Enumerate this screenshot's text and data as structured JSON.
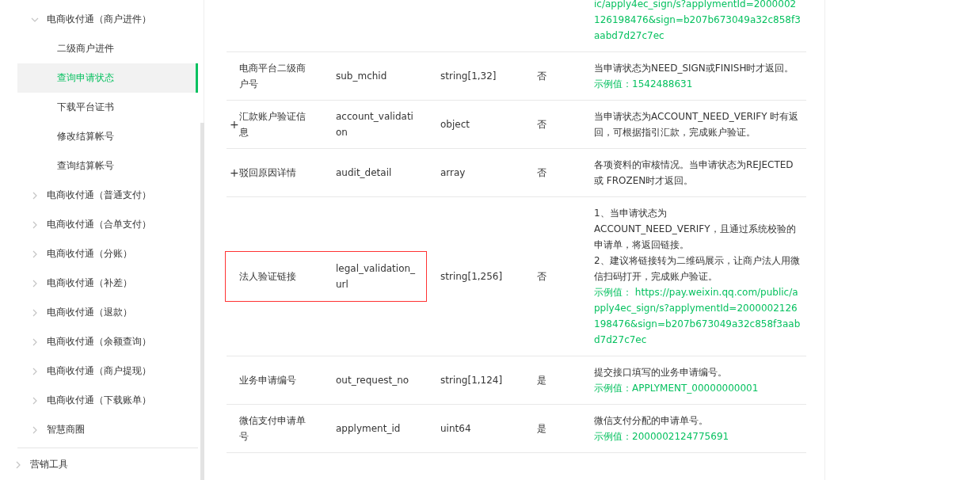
{
  "sidebar": {
    "groups": [
      {
        "items": [
          {
            "label": "电商收付通（商户进件）",
            "expanded": true,
            "children": [
              {
                "label": "二级商户进件",
                "selected": false
              },
              {
                "label": "查询申请状态",
                "selected": true
              },
              {
                "label": "下载平台证书",
                "selected": false
              },
              {
                "label": "修改结算帐号",
                "selected": false
              },
              {
                "label": "查询结算帐号",
                "selected": false
              }
            ]
          },
          {
            "label": "电商收付通（普通支付）",
            "expanded": false
          },
          {
            "label": "电商收付通（合单支付）",
            "expanded": false
          },
          {
            "label": "电商收付通（分账）",
            "expanded": false
          },
          {
            "label": "电商收付通（补差）",
            "expanded": false
          },
          {
            "label": "电商收付通（退款）",
            "expanded": false
          },
          {
            "label": "电商收付通（余额查询）",
            "expanded": false
          },
          {
            "label": "电商收付通（商户提现）",
            "expanded": false
          },
          {
            "label": "电商收付通（下载账单）",
            "expanded": false
          },
          {
            "label": "智慧商圈",
            "expanded": false
          }
        ]
      },
      {
        "items": [
          {
            "label": "营销工具",
            "expanded": false
          }
        ]
      }
    ]
  },
  "table": {
    "rows": [
      {
        "name": "",
        "field": "",
        "type": "",
        "required": "",
        "description": "",
        "example": "ic/apply4ec_sign/s?applymentId=2000002126198476&sign=b207b673049a32c858f3aabd7d27c7ec",
        "highlighted": false
      },
      {
        "name": "电商平台二级商户号",
        "field": "sub_mchid",
        "type": "string[1,32]",
        "required": "否",
        "description": "当申请状态为NEED_SIGN或FINISH时才返回。",
        "example": "示例值：1542488631",
        "highlighted": false
      },
      {
        "expander": "+",
        "name": "汇款账户验证信息",
        "field": "account_validati\non",
        "type": "object",
        "required": "否",
        "description": "当申请状态为ACCOUNT_NEED_VERIFY 时有返回，可根据指引汇款，完成账户验证。",
        "highlighted": false
      },
      {
        "expander": "+",
        "name": "驳回原因详情",
        "field": "audit_detail",
        "type": "array",
        "required": "否",
        "description": "各项资料的审核情况。当申请状态为REJECTED或 FROZEN时才返回。",
        "highlighted": false
      },
      {
        "name": "法人验证链接",
        "field": "legal_validation_\nurl",
        "type": "string[1,256]",
        "required": "否",
        "description": "1、当申请状态为\nACCOUNT_NEED_VERIFY，且通过系统校验的申请单，将返回链接。\n2、建议将链接转为二维码展示，让商户法人用微信扫码打开，完成账户验证。",
        "example": "示例值： https://pay.weixin.qq.com/public/apply4ec_sign/s?applymentId=2000002126198476&sign=b207b673049a32c858f3aabd7d27c7ec",
        "highlighted": true
      },
      {
        "name": "业务申请编号",
        "field": "out_request_no",
        "type": "string[1,124]",
        "required": "是",
        "description": "提交接口填写的业务申请编号。",
        "example": "示例值：APPLYMENT_00000000001",
        "highlighted": false
      },
      {
        "name": "微信支付申请单号",
        "field": "applyment_id",
        "type": "uint64",
        "required": "是",
        "description": "微信支付分配的申请单号。",
        "example": "示例值：2000002124775691",
        "highlighted": false
      }
    ]
  }
}
